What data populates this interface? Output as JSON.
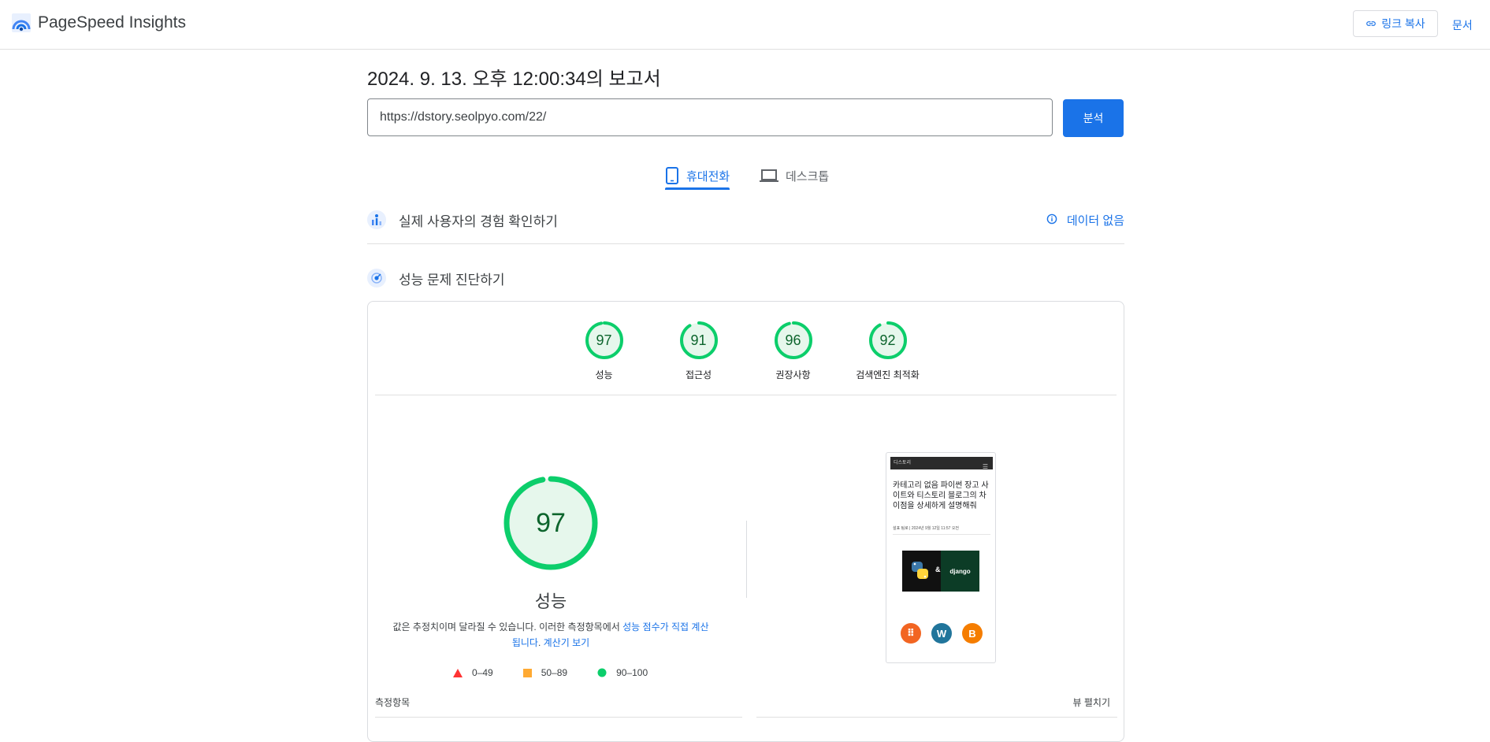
{
  "app": {
    "name": "PageSpeed Insights"
  },
  "header": {
    "copy_link_label": "링크 복사",
    "docs_label": "문서"
  },
  "report": {
    "title": "2024. 9. 13. 오후 12:00:34의 보고서"
  },
  "url_bar": {
    "value": "https://dstory.seolpyo.com/22/",
    "analyze_label": "분석"
  },
  "tabs": [
    {
      "label": "휴대전화",
      "active": true,
      "icon": "smartphone-icon"
    },
    {
      "label": "데스크톱",
      "active": false,
      "icon": "laptop-icon"
    }
  ],
  "field_data": {
    "title": "실제 사용자의 경험 확인하기",
    "status": "데이터 없음"
  },
  "diagnostics": {
    "title": "성능 문제 진단하기"
  },
  "categories": [
    {
      "score": "97",
      "label": "성능"
    },
    {
      "score": "91",
      "label": "접근성"
    },
    {
      "score": "96",
      "label": "권장사항"
    },
    {
      "score": "92",
      "label": "검색엔진 최적화"
    }
  ],
  "performance": {
    "score": "97",
    "label": "성능",
    "note_text": "값은 추정치이며 달라질 수 있습니다. 이러한 측정항목에서 ",
    "note_link1": "성능 점수가 직접 계산됩니다",
    "note_sep": ". ",
    "note_link2": "계산기 보기",
    "legend": [
      {
        "range": "0–49",
        "color": "#ff3333"
      },
      {
        "range": "50–89",
        "color": "#ffaa33"
      },
      {
        "range": "90–100",
        "color": "#0cce6b"
      }
    ]
  },
  "screenshot": {
    "site_name": "디스토리",
    "post_title": "카테고리 없음 파이썬 장고 사이트와 티스토리 블로그의 차이점을 상세하게 설명해줘",
    "post_meta": "설표 팀로 | 2024년 9월 12일 11:57 오전",
    "image_text": "django",
    "image_amp": "&"
  },
  "metrics": {
    "label": "측정항목",
    "expand_label": "뷰 펼치기"
  },
  "colors": {
    "accent": "#1a73e8",
    "pass": "#0cce6b",
    "pass_text": "#0d652d",
    "pass_fill": "#e6f7ec"
  }
}
